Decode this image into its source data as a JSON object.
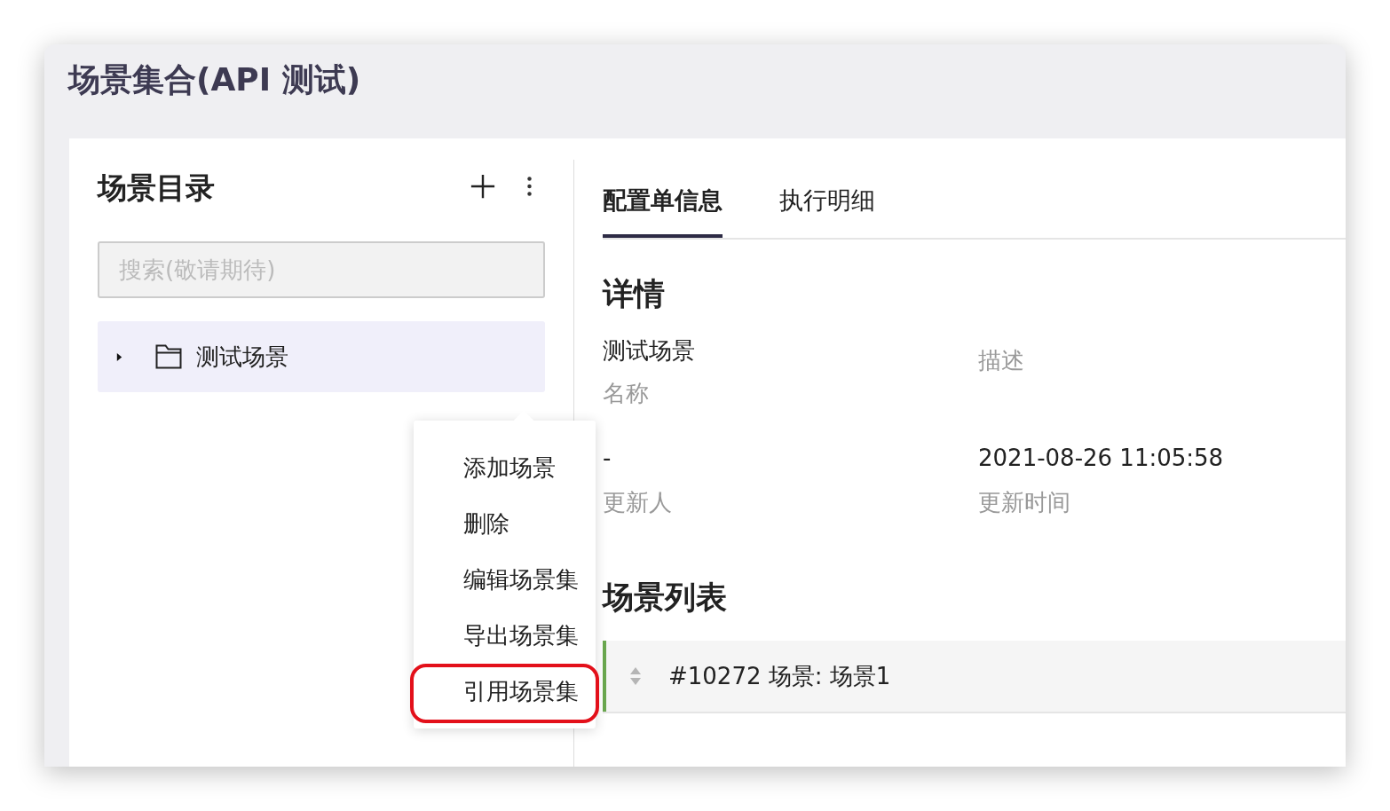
{
  "window": {
    "title": "场景集合(API 测试)"
  },
  "sidebar": {
    "title": "场景目录",
    "search": {
      "placeholder": "搜索(敬请期待)"
    },
    "tree": [
      {
        "label": "测试场景",
        "selected": true,
        "expanded": false
      }
    ]
  },
  "context_menu": {
    "items": [
      {
        "label": "添加场景",
        "highlighted": false
      },
      {
        "label": "删除",
        "highlighted": false
      },
      {
        "label": "编辑场景集",
        "highlighted": false
      },
      {
        "label": "导出场景集",
        "highlighted": false
      },
      {
        "label": "引用场景集",
        "highlighted": true
      }
    ]
  },
  "tabs": [
    {
      "label": "配置单信息",
      "selected": true
    },
    {
      "label": "执行明细",
      "selected": false
    }
  ],
  "details": {
    "heading": "详情",
    "fields": [
      {
        "value": "测试场景",
        "label": "名称"
      },
      {
        "label": "描述"
      },
      {
        "value": "-",
        "label": "更新人"
      },
      {
        "value": "2021-08-26 11:05:58",
        "label": "更新时间"
      }
    ]
  },
  "scene_list": {
    "heading": "场景列表",
    "rows": [
      {
        "text": "#10272 场景: 场景1",
        "color": "#6aa84f"
      }
    ]
  }
}
